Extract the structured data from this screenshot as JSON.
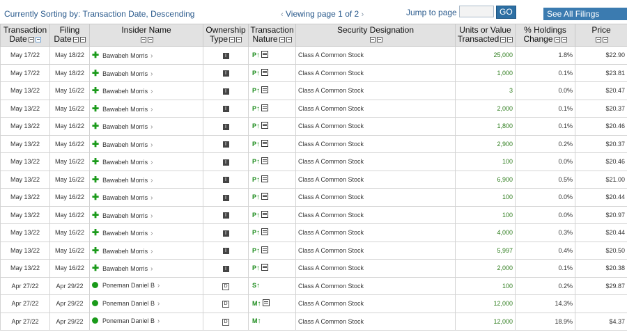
{
  "header": {
    "sort_status": "Currently Sorting by: Transaction Date, Descending",
    "pager_text": "Viewing page 1 of 2",
    "prev_arrow": "‹",
    "next_arrow": "›",
    "jump_label": "Jump to page",
    "jump_value": "",
    "go_label": "GO",
    "all_filings_label": "See All Filings Details"
  },
  "columns": [
    {
      "l1": "Transaction",
      "l2": "Date"
    },
    {
      "l1": "Filing",
      "l2": "Date"
    },
    {
      "l1": "Insider Name",
      "l2": ""
    },
    {
      "l1": "Ownership",
      "l2": "Type"
    },
    {
      "l1": "Transaction",
      "l2": "Nature"
    },
    {
      "l1": "Security Designation",
      "l2": ""
    },
    {
      "l1": "Units or Value",
      "l2": "Transacted"
    },
    {
      "l1": "% Holdings",
      "l2": "Change"
    },
    {
      "l1": "Price",
      "l2": ""
    }
  ],
  "rows": [
    {
      "tdate": "May 17/22",
      "fdate": "May 18/22",
      "marker": "plus",
      "name": "Bawabeh Morris",
      "own": "I",
      "nature": "P",
      "doc": true,
      "security": "Class A Common Stock",
      "units": "25,000",
      "pct": "1.8%",
      "price": "$22.90"
    },
    {
      "tdate": "May 17/22",
      "fdate": "May 18/22",
      "marker": "plus",
      "name": "Bawabeh Morris",
      "own": "I",
      "nature": "P",
      "doc": true,
      "security": "Class A Common Stock",
      "units": "1,000",
      "pct": "0.1%",
      "price": "$23.81"
    },
    {
      "tdate": "May 13/22",
      "fdate": "May 16/22",
      "marker": "plus",
      "name": "Bawabeh Morris",
      "own": "I",
      "nature": "P",
      "doc": true,
      "security": "Class A Common Stock",
      "units": "3",
      "pct": "0.0%",
      "price": "$20.47"
    },
    {
      "tdate": "May 13/22",
      "fdate": "May 16/22",
      "marker": "plus",
      "name": "Bawabeh Morris",
      "own": "I",
      "nature": "P",
      "doc": true,
      "security": "Class A Common Stock",
      "units": "2,000",
      "pct": "0.1%",
      "price": "$20.37"
    },
    {
      "tdate": "May 13/22",
      "fdate": "May 16/22",
      "marker": "plus",
      "name": "Bawabeh Morris",
      "own": "I",
      "nature": "P",
      "doc": true,
      "security": "Class A Common Stock",
      "units": "1,800",
      "pct": "0.1%",
      "price": "$20.46"
    },
    {
      "tdate": "May 13/22",
      "fdate": "May 16/22",
      "marker": "plus",
      "name": "Bawabeh Morris",
      "own": "I",
      "nature": "P",
      "doc": true,
      "security": "Class A Common Stock",
      "units": "2,900",
      "pct": "0.2%",
      "price": "$20.37"
    },
    {
      "tdate": "May 13/22",
      "fdate": "May 16/22",
      "marker": "plus",
      "name": "Bawabeh Morris",
      "own": "I",
      "nature": "P",
      "doc": true,
      "security": "Class A Common Stock",
      "units": "100",
      "pct": "0.0%",
      "price": "$20.46"
    },
    {
      "tdate": "May 13/22",
      "fdate": "May 16/22",
      "marker": "plus",
      "name": "Bawabeh Morris",
      "own": "I",
      "nature": "P",
      "doc": true,
      "security": "Class A Common Stock",
      "units": "6,900",
      "pct": "0.5%",
      "price": "$21.00"
    },
    {
      "tdate": "May 13/22",
      "fdate": "May 16/22",
      "marker": "plus",
      "name": "Bawabeh Morris",
      "own": "I",
      "nature": "P",
      "doc": true,
      "security": "Class A Common Stock",
      "units": "100",
      "pct": "0.0%",
      "price": "$20.44"
    },
    {
      "tdate": "May 13/22",
      "fdate": "May 16/22",
      "marker": "plus",
      "name": "Bawabeh Morris",
      "own": "I",
      "nature": "P",
      "doc": true,
      "security": "Class A Common Stock",
      "units": "100",
      "pct": "0.0%",
      "price": "$20.97"
    },
    {
      "tdate": "May 13/22",
      "fdate": "May 16/22",
      "marker": "plus",
      "name": "Bawabeh Morris",
      "own": "I",
      "nature": "P",
      "doc": true,
      "security": "Class A Common Stock",
      "units": "4,000",
      "pct": "0.3%",
      "price": "$20.44"
    },
    {
      "tdate": "May 13/22",
      "fdate": "May 16/22",
      "marker": "plus",
      "name": "Bawabeh Morris",
      "own": "I",
      "nature": "P",
      "doc": true,
      "security": "Class A Common Stock",
      "units": "5,997",
      "pct": "0.4%",
      "price": "$20.50"
    },
    {
      "tdate": "May 13/22",
      "fdate": "May 16/22",
      "marker": "plus",
      "name": "Bawabeh Morris",
      "own": "I",
      "nature": "P",
      "doc": true,
      "security": "Class A Common Stock",
      "units": "2,000",
      "pct": "0.1%",
      "price": "$20.38"
    },
    {
      "tdate": "Apr 27/22",
      "fdate": "Apr 29/22",
      "marker": "dot",
      "name": "Poneman Daniel B",
      "own": "D",
      "nature": "S",
      "doc": false,
      "security": "Class A Common Stock",
      "units": "100",
      "pct": "0.2%",
      "price": "$29.87"
    },
    {
      "tdate": "Apr 27/22",
      "fdate": "Apr 29/22",
      "marker": "dot",
      "name": "Poneman Daniel B",
      "own": "D",
      "nature": "M",
      "doc": true,
      "security": "Class A Common Stock",
      "units": "12,000",
      "pct": "14.3%",
      "price": ""
    },
    {
      "tdate": "Apr 27/22",
      "fdate": "Apr 29/22",
      "marker": "dot",
      "name": "Poneman Daniel B",
      "own": "D",
      "nature": "M",
      "doc": false,
      "security": "Class A Common Stock",
      "units": "12,000",
      "pct": "18.9%",
      "price": "$4.37"
    }
  ],
  "icons": {
    "plus": "plus-icon",
    "dot": "dot-icon",
    "chevron": "chevron-right-icon",
    "up": "arrow-up-icon",
    "doc": "document-icon"
  },
  "colors": {
    "link": "#2a5a8c",
    "button": "#3b7bb0",
    "units": "#2e7d1d",
    "marker": "#1a9a1a",
    "header_bg": "#e2e2e2"
  }
}
